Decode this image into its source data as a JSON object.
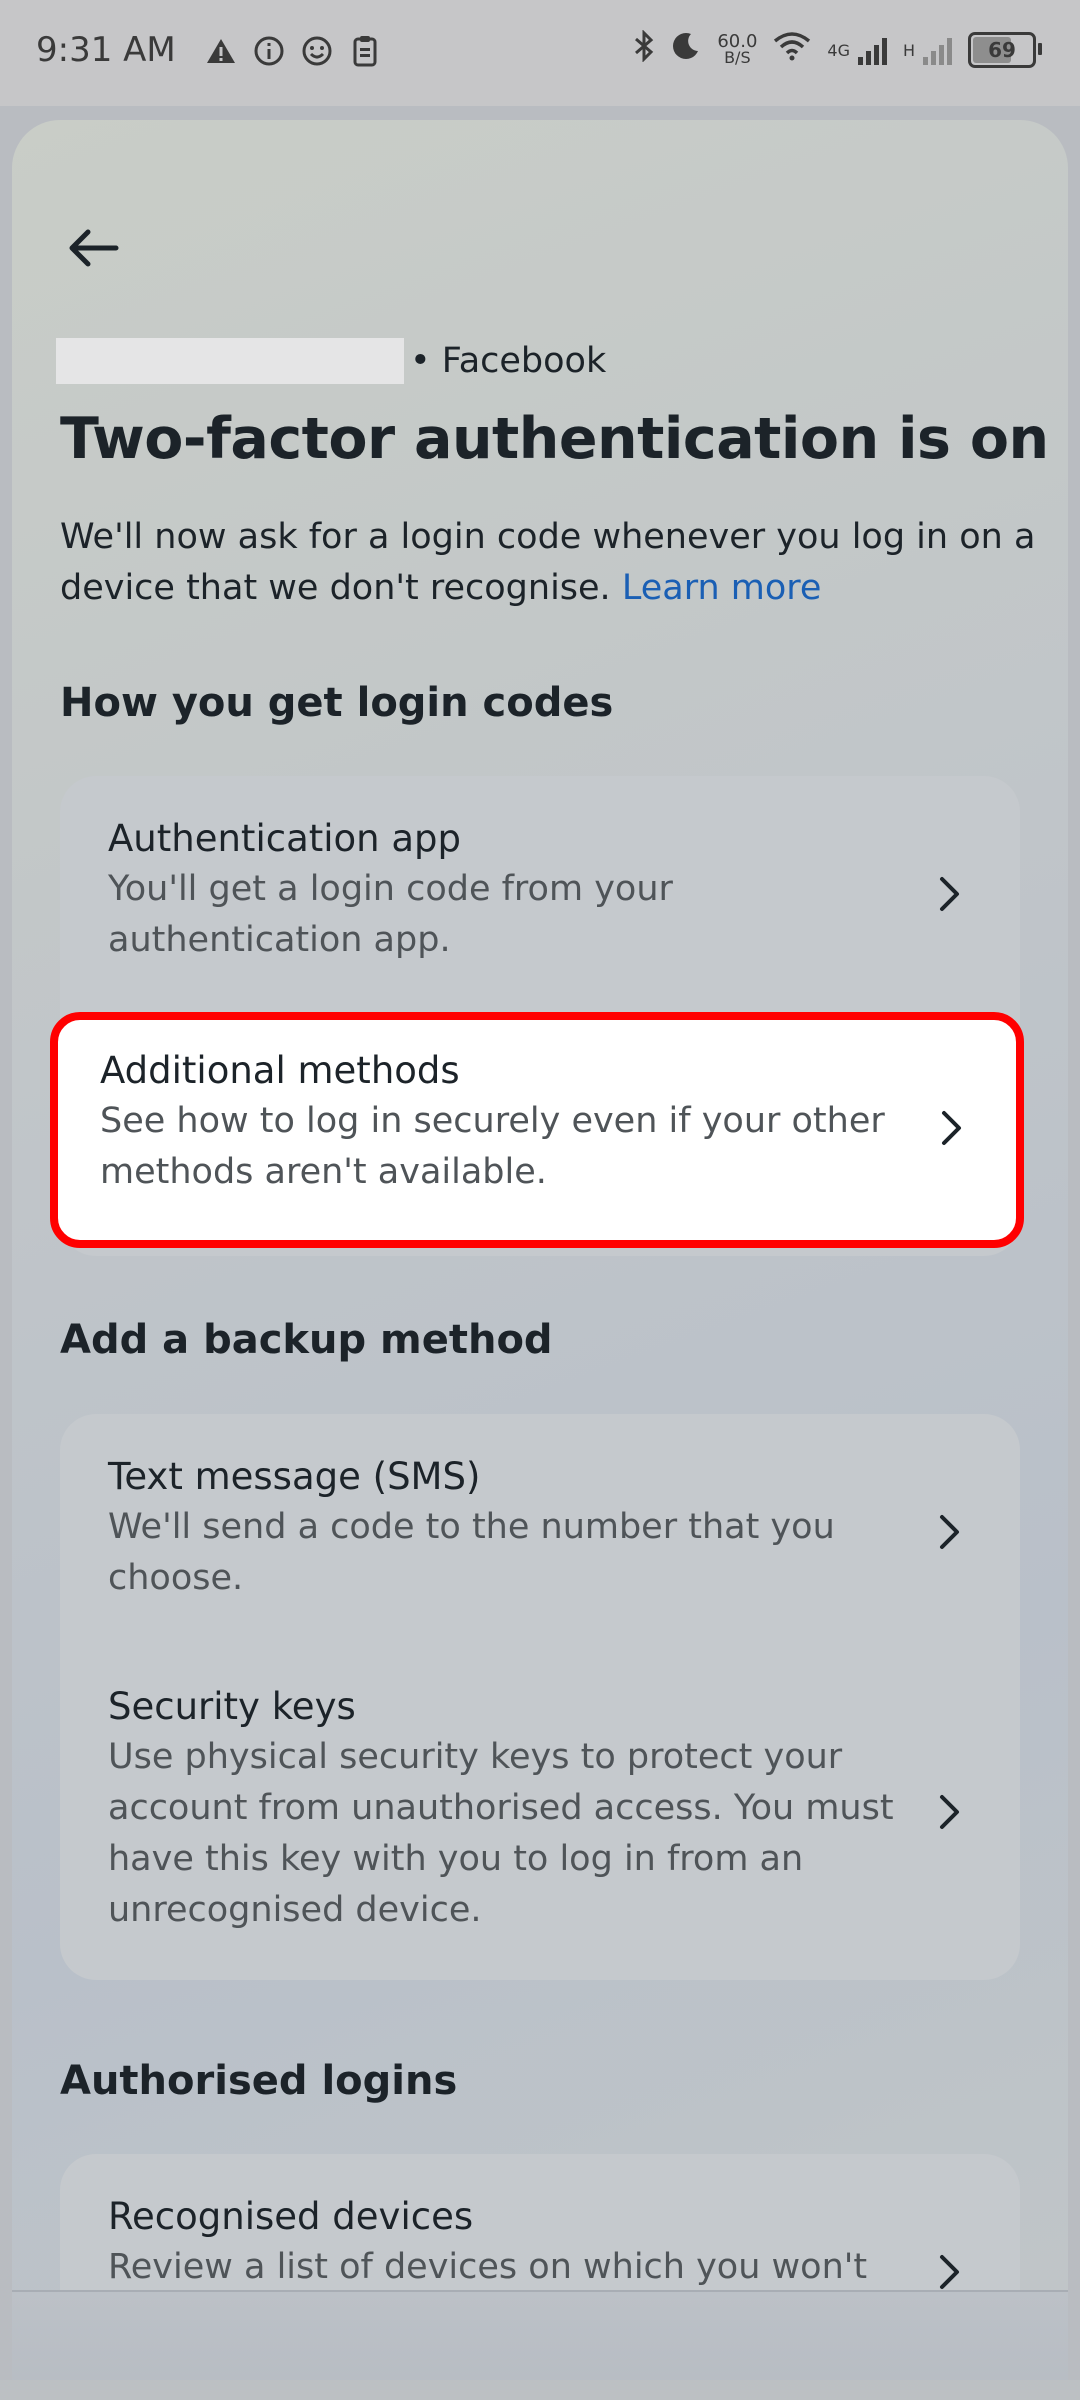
{
  "status_bar": {
    "time": "9:31 AM",
    "net_speed_value": "60.0",
    "net_speed_unit": "B/S",
    "network_4g": "4G",
    "network_h": "H",
    "battery": "69"
  },
  "header": {
    "source": "• Facebook",
    "title": "Two-factor authentication is on",
    "description": "We'll now ask for a login code whenever you log in on a device that we don't recognise.",
    "learn_more": "Learn more"
  },
  "login_codes": {
    "heading": "How you get login codes",
    "items": [
      {
        "title": "Authentication app",
        "subtitle": "You'll get a login code from your authentication app."
      },
      {
        "title": "Additional methods",
        "subtitle": "See how to log in securely even if your other methods aren't available."
      }
    ]
  },
  "backup": {
    "heading": "Add a backup method",
    "items": [
      {
        "title": "Text message (SMS)",
        "subtitle": "We'll send a code to the number that you choose."
      },
      {
        "title": "Security keys",
        "subtitle": "Use physical security keys to protect your account from unauthorised access. You must have this key with you to log in from an unrecognised device."
      }
    ]
  },
  "authorised": {
    "heading": "Authorised logins",
    "items": [
      {
        "title": "Recognised devices",
        "subtitle": "Review a list of devices on which you won't"
      }
    ]
  },
  "icons": {
    "back": "arrow-left-icon",
    "chevron": "chevron-right-icon"
  },
  "colors": {
    "highlight_border": "#ff0000",
    "link": "#1a5fb4"
  }
}
